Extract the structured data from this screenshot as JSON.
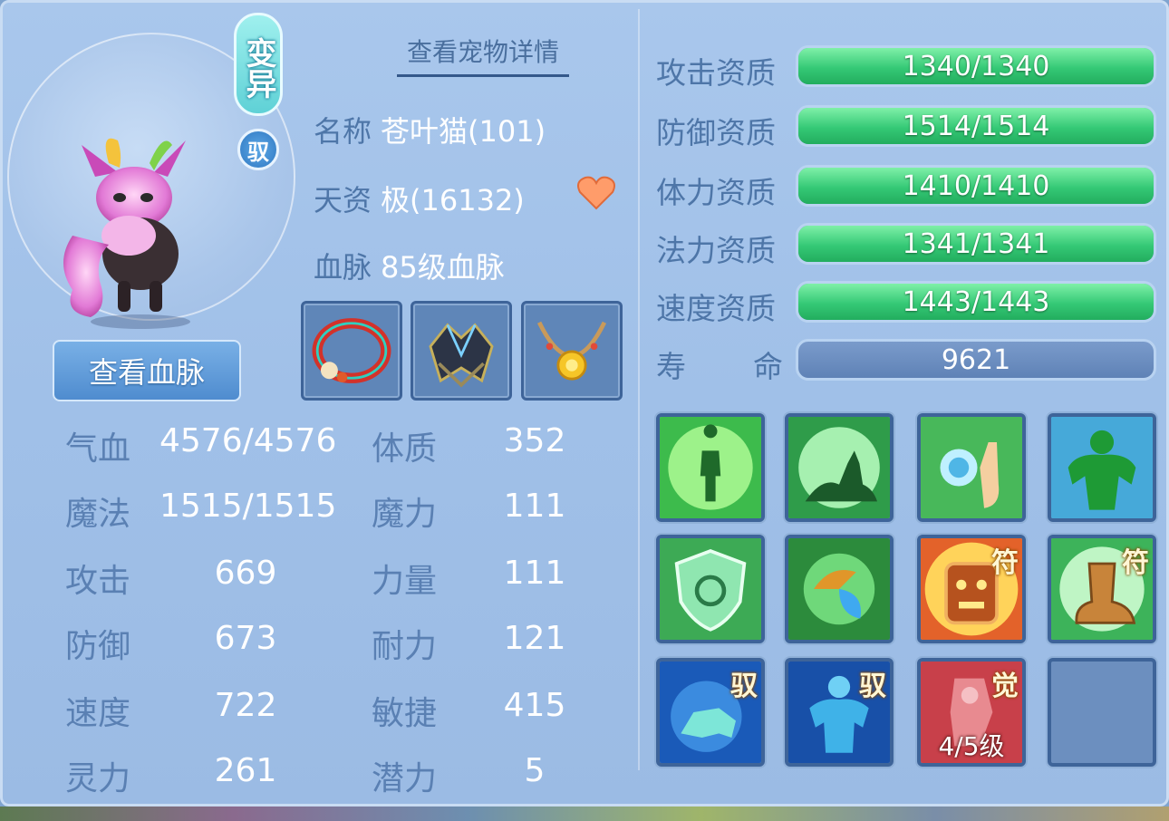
{
  "header": {
    "detail_link": "查看宠物详情"
  },
  "badges": {
    "mutation": "变异",
    "ride": "驭"
  },
  "pet_info": {
    "name_label": "名称",
    "name_value": "苍叶猫(101)",
    "aptitude_label": "天资",
    "aptitude_value": "极(16132)",
    "bloodline_label": "血脉",
    "bloodline_value": "85级血脉"
  },
  "bloodline_button": "查看血脉",
  "equipment": [
    {
      "name": "collar-icon"
    },
    {
      "name": "armor-icon"
    },
    {
      "name": "necklace-icon"
    }
  ],
  "stats_left": [
    {
      "label": "气血",
      "value": "4576/4576"
    },
    {
      "label": "魔法",
      "value": "1515/1515"
    },
    {
      "label": "攻击",
      "value": "669"
    },
    {
      "label": "防御",
      "value": "673"
    },
    {
      "label": "速度",
      "value": "722"
    },
    {
      "label": "灵力",
      "value": "261"
    }
  ],
  "stats_right": [
    {
      "label": "体质",
      "value": "352"
    },
    {
      "label": "魔力",
      "value": "111"
    },
    {
      "label": "力量",
      "value": "111"
    },
    {
      "label": "耐力",
      "value": "121"
    },
    {
      "label": "敏捷",
      "value": "415"
    },
    {
      "label": "潜力",
      "value": "5"
    }
  ],
  "aptitudes": [
    {
      "label": "攻击资质",
      "text": "1340/1340",
      "fill": 1.0
    },
    {
      "label": "防御资质",
      "text": "1514/1514",
      "fill": 1.0
    },
    {
      "label": "体力资质",
      "text": "1410/1410",
      "fill": 1.0
    },
    {
      "label": "法力资质",
      "text": "1341/1341",
      "fill": 1.0
    },
    {
      "label": "速度资质",
      "text": "1443/1443",
      "fill": 1.0
    }
  ],
  "lifespan": {
    "label_1": "寿",
    "label_2": "命",
    "value": "9621"
  },
  "skills": [
    {
      "icon": "silhouette-aura-icon",
      "tag": "",
      "level": ""
    },
    {
      "icon": "centaur-icon",
      "tag": "",
      "level": ""
    },
    {
      "icon": "water-hand-icon",
      "tag": "",
      "level": ""
    },
    {
      "icon": "green-muscle-icon",
      "tag": "",
      "level": ""
    },
    {
      "icon": "shield-icon",
      "tag": "",
      "level": ""
    },
    {
      "icon": "elements-orb-icon",
      "tag": "",
      "level": ""
    },
    {
      "icon": "mask-charm-icon",
      "tag": "符",
      "level": ""
    },
    {
      "icon": "boot-charm-icon",
      "tag": "符",
      "level": ""
    },
    {
      "icon": "blue-beast-icon",
      "tag": "驭",
      "level": ""
    },
    {
      "icon": "blue-giant-icon",
      "tag": "驭",
      "level": ""
    },
    {
      "icon": "red-awaken-icon",
      "tag": "觉",
      "level": "4/5级"
    },
    {
      "icon": "empty-slot",
      "tag": "",
      "level": ""
    }
  ]
}
